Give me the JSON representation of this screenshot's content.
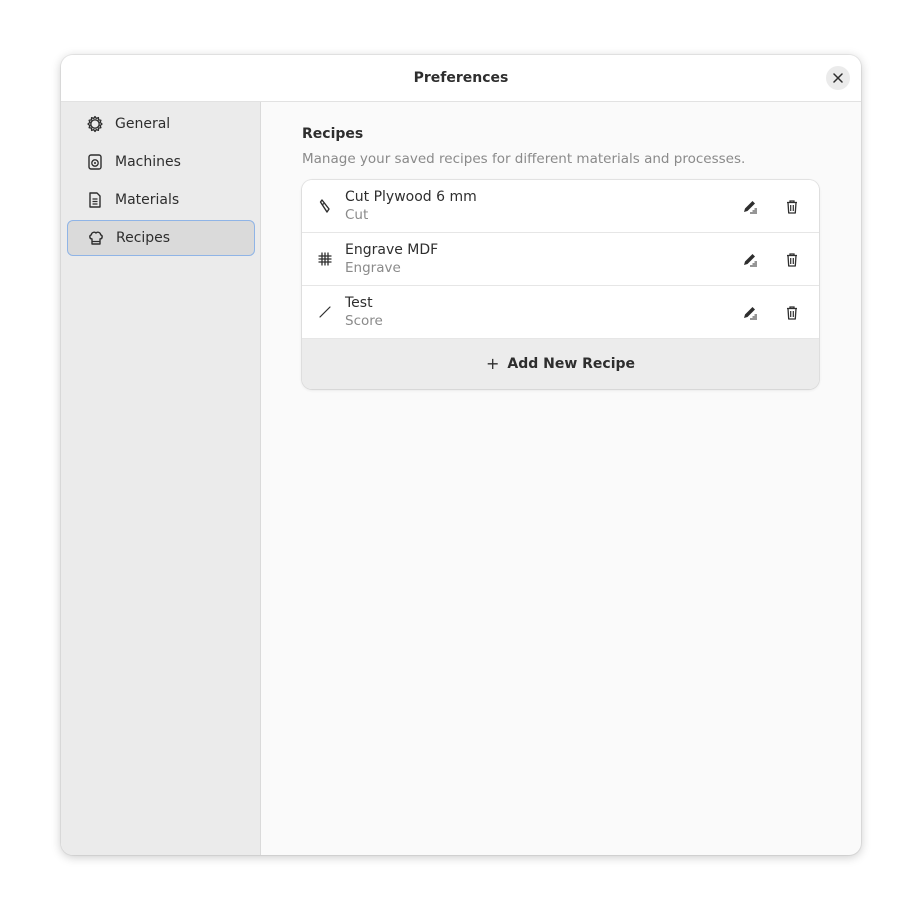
{
  "window": {
    "title": "Preferences"
  },
  "sidebar": {
    "items": [
      {
        "label": "General",
        "icon": "gear-icon"
      },
      {
        "label": "Machines",
        "icon": "machine-icon"
      },
      {
        "label": "Materials",
        "icon": "document-icon"
      },
      {
        "label": "Recipes",
        "icon": "chef-hat-icon",
        "selected": true
      }
    ]
  },
  "recipes": {
    "title": "Recipes",
    "description": "Manage your saved recipes for different materials and processes.",
    "items": [
      {
        "name": "Cut Plywood 6 mm",
        "type": "Cut",
        "icon": "knife-icon"
      },
      {
        "name": "Engrave MDF",
        "type": "Engrave",
        "icon": "grid-icon"
      },
      {
        "name": "Test",
        "type": "Score",
        "icon": "line-icon"
      }
    ],
    "add_label": "Add New Recipe",
    "add_icon": "plus-icon"
  },
  "colors": {
    "selection_border": "#8fb4e6",
    "sidebar_bg": "#ebebeb",
    "window_bg": "#fafafa",
    "text": "#2e2e2e",
    "muted_text": "#8a8a8a"
  }
}
